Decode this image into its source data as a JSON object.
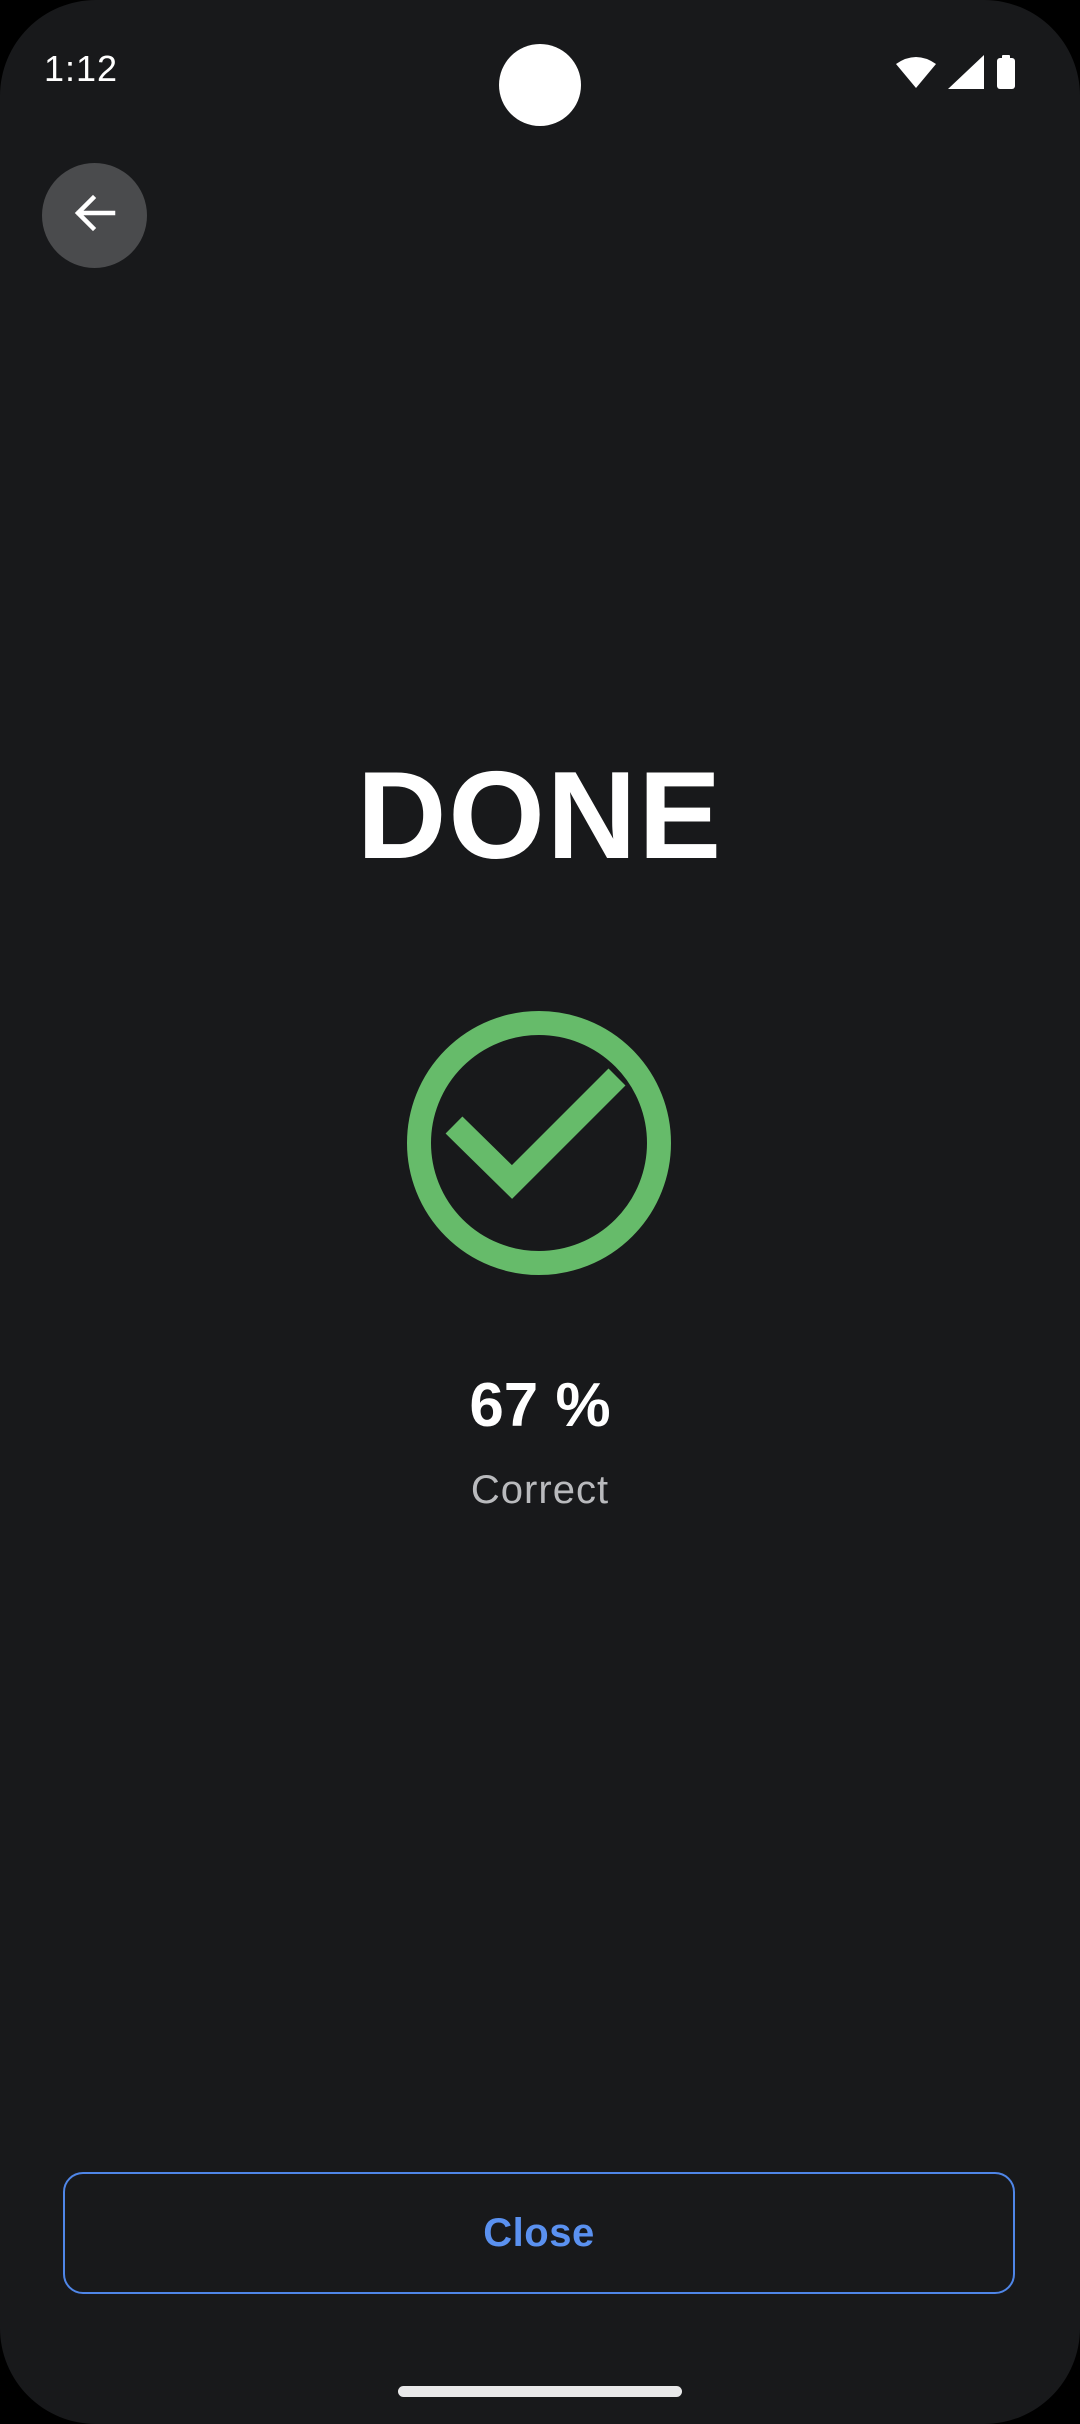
{
  "status_bar": {
    "time": "1:12",
    "icons": [
      "wifi-icon",
      "cellular-signal-icon",
      "battery-icon"
    ]
  },
  "toolbar": {
    "back_icon": "arrow-left-icon"
  },
  "result": {
    "title": "DONE",
    "icon": "check-circle-icon",
    "score": "67 %",
    "score_label": "Correct"
  },
  "actions": {
    "close_label": "Close"
  },
  "colors": {
    "background": "#18191b",
    "success_green": "#66bb6a",
    "accent_blue": "#5a91f0",
    "back_button_bg": "#4a4b4d"
  }
}
